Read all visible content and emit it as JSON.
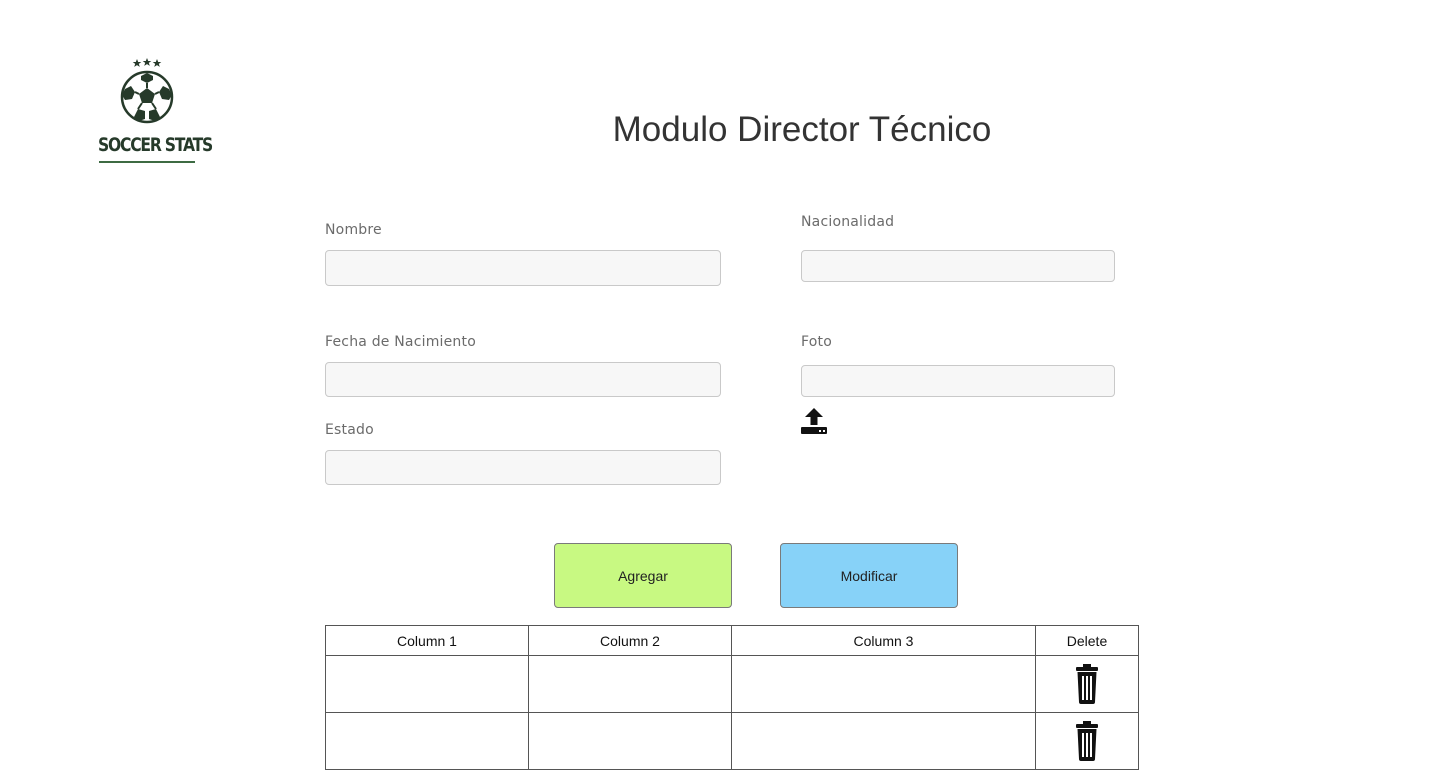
{
  "logo": {
    "text": "SOCCER STATS",
    "icon": "soccer-ball-icon"
  },
  "title": "Modulo Director Técnico",
  "form": {
    "nombre": {
      "label": "Nombre",
      "value": "",
      "placeholder": ""
    },
    "nacionalidad": {
      "label": "Nacionalidad",
      "value": "",
      "placeholder": ""
    },
    "fecha_nacimiento": {
      "label": "Fecha de Nacimiento",
      "value": "",
      "placeholder": ""
    },
    "foto": {
      "label": "Foto",
      "value": "",
      "placeholder": ""
    },
    "estado": {
      "label": "Estado",
      "value": "",
      "placeholder": ""
    },
    "upload_icon": "upload-icon"
  },
  "buttons": {
    "agregar": {
      "label": "Agregar",
      "color": "#c8f982"
    },
    "modificar": {
      "label": "Modificar",
      "color": "#87d2f8"
    }
  },
  "table": {
    "columns": [
      "Column 1",
      "Column 2",
      "Column 3",
      "Delete"
    ],
    "rows": [
      [
        "",
        "",
        ""
      ],
      [
        "",
        "",
        ""
      ]
    ],
    "delete_icon": "trash-icon"
  }
}
